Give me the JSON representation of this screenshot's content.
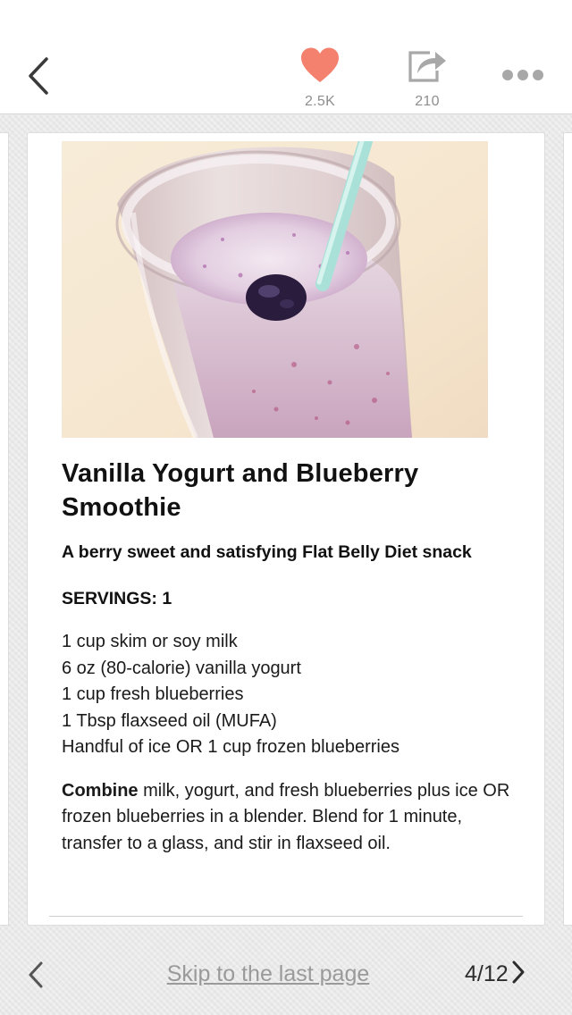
{
  "toolbar": {
    "likes_count": "2.5K",
    "shares_count": "210",
    "icons": {
      "back": "chevron-left-icon",
      "like": "heart-icon",
      "share": "share-icon",
      "more": "more-dots-icon"
    },
    "colors": {
      "heart": "#f4806e",
      "icon_gray": "#a8a8a8"
    }
  },
  "recipe": {
    "title": "Vanilla Yogurt and Blueberry Smoothie",
    "subtitle": "A berry sweet and satisfying Flat Belly Diet snack",
    "servings": "SERVINGS: 1",
    "ingredients": [
      "1 cup skim or soy milk",
      "6 oz (80-calorie) vanilla yogurt",
      "1 cup fresh blueberries",
      "1 Tbsp flaxseed oil (MUFA)",
      "Handful of ice OR 1 cup frozen blueberries"
    ],
    "directions_lead": "Combine",
    "directions_text": " milk, yogurt, and fresh blueberries plus ice OR frozen blueberries in a blender. Blend for 1 minute, transfer to a glass, and stir in flaxseed oil."
  },
  "footer": {
    "skip_label": "Skip to the last page",
    "page_indicator": "4/12"
  }
}
